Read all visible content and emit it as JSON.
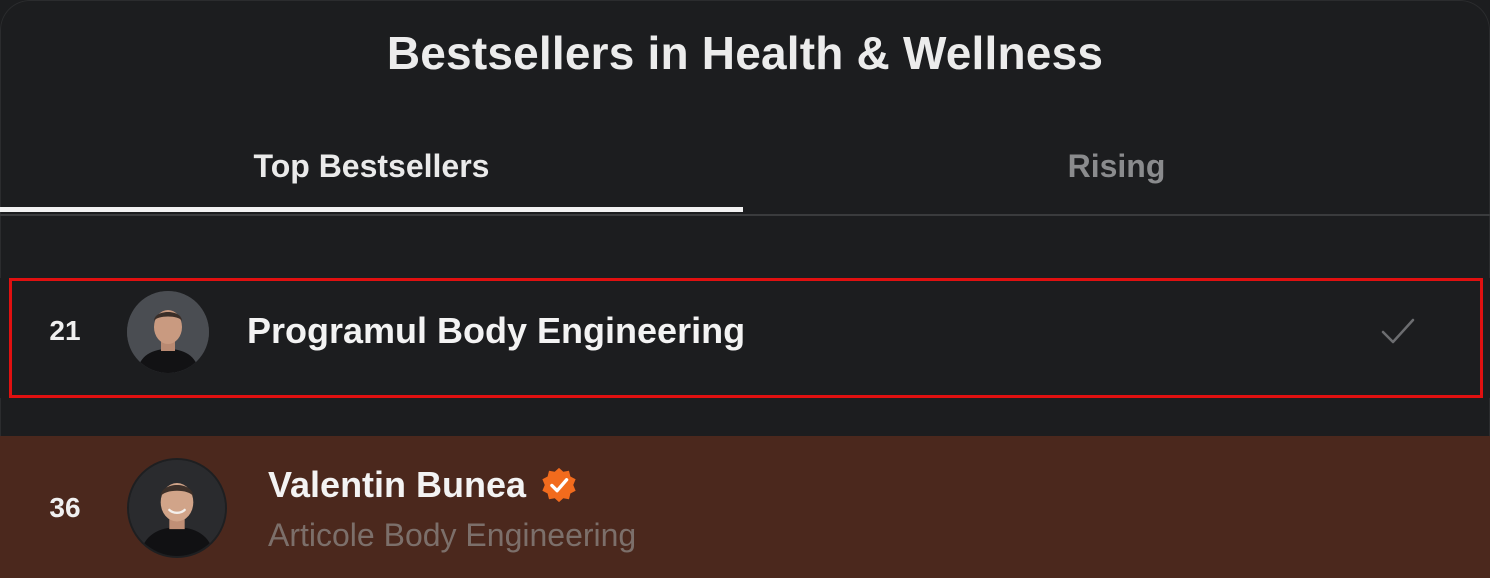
{
  "header": {
    "title": "Bestsellers in Health & Wellness"
  },
  "tabs": [
    {
      "label": "Top Bestsellers",
      "active": true
    },
    {
      "label": "Rising",
      "active": false
    }
  ],
  "list": {
    "items": [
      {
        "rank": "21",
        "title": "Programul Body Engineering",
        "subtitle": "",
        "status_icon": "checkmark-icon",
        "highlighted": true
      },
      {
        "rank": "36",
        "title": "Valentin Bunea",
        "subtitle": "Articole Body Engineering",
        "badge_icon": "verified-badge-icon"
      }
    ]
  },
  "colors": {
    "background": "#1c1d1f",
    "active_tab_text": "#eaeaea",
    "inactive_tab_text": "#8a8b8d",
    "highlight_outline": "#e01010",
    "featured_row_bg": "#4b281d",
    "verified_badge": "#f26b1d"
  }
}
